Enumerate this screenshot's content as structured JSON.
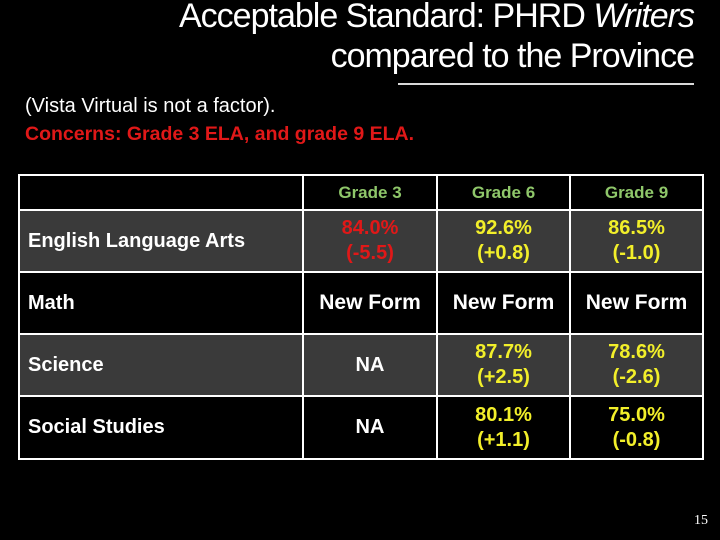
{
  "title": {
    "line1_prefix": "Acceptable Standard:  PHRD ",
    "line1_italic": "Writers",
    "line2": "compared to the Province"
  },
  "subtitle": {
    "note": "(Vista Virtual is not a factor).",
    "concerns": "Concerns:  Grade 3 ELA, and grade 9 ELA."
  },
  "table": {
    "columns": [
      "",
      "Grade 3",
      "Grade 6",
      "Grade 9"
    ],
    "rows": [
      {
        "subject": "English Language Arts",
        "cells": [
          {
            "pct": "84.0%",
            "chg": "(-5.5)",
            "status": "concern"
          },
          {
            "pct": "92.6%",
            "chg": "(+0.8)",
            "status": "ok"
          },
          {
            "pct": "86.5%",
            "chg": "(-1.0)",
            "status": "ok"
          }
        ]
      },
      {
        "subject": "Math",
        "cells": [
          {
            "text": "New Form"
          },
          {
            "text": "New Form"
          },
          {
            "text": "New Form"
          }
        ]
      },
      {
        "subject": "Science",
        "cells": [
          {
            "text": "NA"
          },
          {
            "pct": "87.7%",
            "chg": "(+2.5)",
            "status": "ok"
          },
          {
            "pct": "78.6%",
            "chg": "(-2.6)",
            "status": "ok"
          }
        ]
      },
      {
        "subject": "Social Studies",
        "cells": [
          {
            "text": "NA"
          },
          {
            "pct": "80.1%",
            "chg": "(+1.1)",
            "status": "ok"
          },
          {
            "pct": "75.0%",
            "chg": "(-0.8)",
            "status": "ok"
          }
        ]
      }
    ]
  },
  "colors": {
    "header_text": "#8fc76a",
    "concern": "#e01818",
    "ok": "#f2ef2a",
    "alt_row_bg": "#3a3a3a"
  },
  "page_number": "15"
}
